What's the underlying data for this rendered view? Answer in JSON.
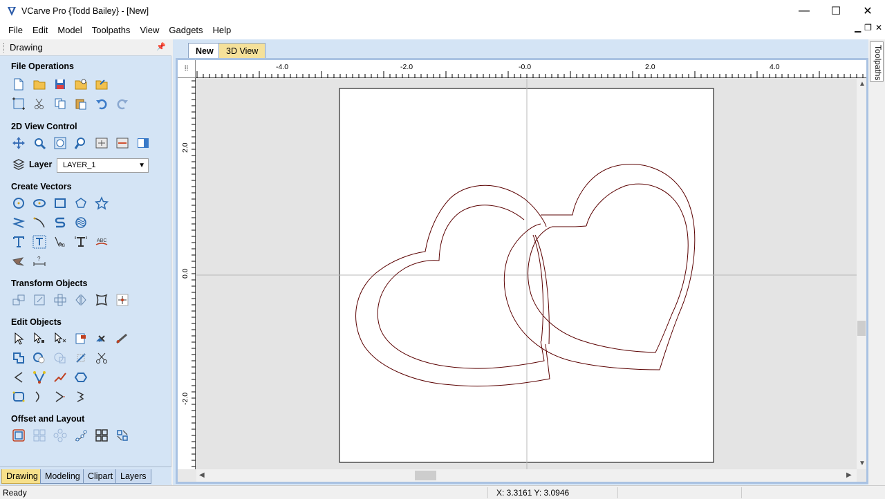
{
  "window": {
    "title": "VCarve Pro {Todd Bailey} - [New]",
    "minimize": "—",
    "maximize": "☐",
    "close": "✕"
  },
  "menu": [
    "File",
    "Edit",
    "Model",
    "Toolpaths",
    "View",
    "Gadgets",
    "Help"
  ],
  "mdi_controls": {
    "minimize": "▁",
    "restore": "❐",
    "close": "✕"
  },
  "panel": {
    "title": "Drawing",
    "pin": "🖈",
    "sections": {
      "file_operations": "File Operations",
      "view_control": "2D View Control",
      "create_vectors": "Create Vectors",
      "transform_objects": "Transform Objects",
      "edit_objects": "Edit Objects",
      "offset_layout": "Offset and Layout"
    },
    "layer": {
      "label": "Layer",
      "value": "LAYER_1",
      "arrow": "▼"
    },
    "bottom_tabs": [
      "Drawing",
      "Modeling",
      "Clipart",
      "Layers"
    ]
  },
  "document": {
    "tabs": [
      "New",
      "3D View"
    ],
    "active_tab": "New",
    "hruler_labels": [
      "-4.0",
      "-2.0",
      "-0.0",
      "2.0",
      "4.0"
    ],
    "vruler_labels": [
      "2.0",
      "0.0",
      "-2.0"
    ]
  },
  "right_panel": {
    "label": "Toolpaths"
  },
  "status": {
    "text": "Ready",
    "coords": "X:  3.3161 Y:  3.0946"
  },
  "colors": {
    "panel_bg": "#d4e4f5",
    "active_tab": "#f7e08a",
    "vector_line": "#5a0000"
  }
}
